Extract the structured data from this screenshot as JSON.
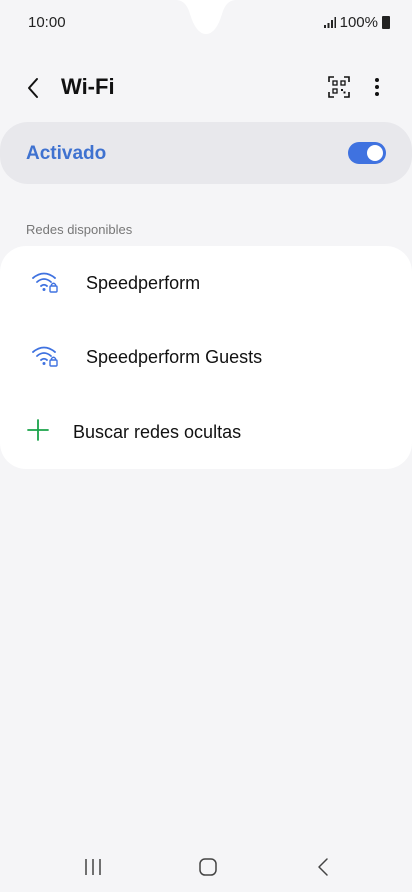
{
  "status_bar": {
    "time": "10:00",
    "battery": "100%"
  },
  "header": {
    "title": "Wi-Fi",
    "back_icon": "chevron-left-icon",
    "qr_icon": "qr-scan-icon",
    "menu_icon": "more-vertical-icon"
  },
  "wifi_toggle": {
    "label": "Activado",
    "state": "on",
    "accent": "#3f72e0"
  },
  "networks": {
    "section_title": "Redes disponibles",
    "items": [
      {
        "name": "Speedperform",
        "icon": "wifi-secured-icon"
      },
      {
        "name": "Speedperform Guests",
        "icon": "wifi-secured-icon"
      }
    ],
    "add_label": "Buscar redes ocultas",
    "add_icon": "plus-icon",
    "add_color": "#1aa34a"
  },
  "nav_bar": {
    "recents_icon": "recents-icon",
    "home_icon": "home-icon",
    "back_icon": "back-icon"
  }
}
